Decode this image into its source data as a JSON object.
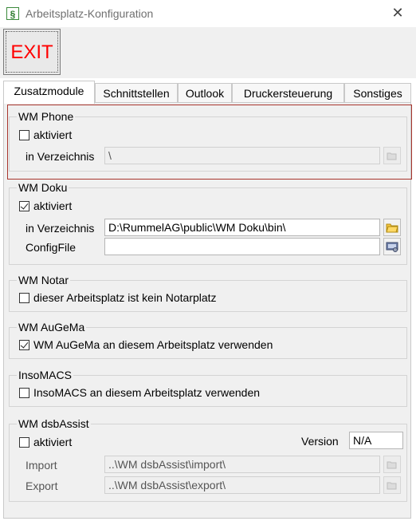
{
  "window": {
    "title": "Arbeitsplatz-Konfiguration",
    "icon_glyph": "§"
  },
  "toolbar": {
    "exit_label": "EXIT"
  },
  "tabs": [
    {
      "label": "Zusatzmodule"
    },
    {
      "label": "Schnittstellen"
    },
    {
      "label": "Outlook"
    },
    {
      "label": "Druckersteuerung"
    },
    {
      "label": "Sonstiges"
    }
  ],
  "wm_phone": {
    "title": "WM Phone",
    "checkbox_label": "aktiviert",
    "checked": false,
    "dir_label": "in Verzeichnis",
    "dir_value": "\\"
  },
  "wm_doku": {
    "title": "WM Doku",
    "checkbox_label": "aktiviert",
    "checked": true,
    "dir_label": "in Verzeichnis",
    "dir_value": "D:\\RummelAG\\public\\WM Doku\\bin\\",
    "config_label": "ConfigFile",
    "config_value": ""
  },
  "wm_notar": {
    "title": "WM Notar",
    "checkbox_label": "dieser Arbeitsplatz ist kein Notarplatz",
    "checked": false
  },
  "wm_augema": {
    "title": "WM AuGeMa",
    "checkbox_label": "WM AuGeMa an diesem Arbeitsplatz verwenden",
    "checked": true
  },
  "insomacs": {
    "title": "InsoMACS",
    "checkbox_label": "InsoMACS an diesem Arbeitsplatz verwenden",
    "checked": false
  },
  "wm_dsbassist": {
    "title": "WM dsbAssist",
    "checkbox_label": "aktiviert",
    "checked": false,
    "version_label": "Version",
    "version_value": "N/A",
    "import_label": "Import",
    "import_value": "..\\WM dsbAssist\\import\\",
    "export_label": "Export",
    "export_value": "..\\WM dsbAssist\\export\\"
  },
  "colors": {
    "exit_text": "#ff0000",
    "highlight_border": "#a8352d",
    "panel_bg": "#f0f0f0"
  },
  "icons": [
    "close-icon",
    "folder-icon",
    "config-icon"
  ]
}
